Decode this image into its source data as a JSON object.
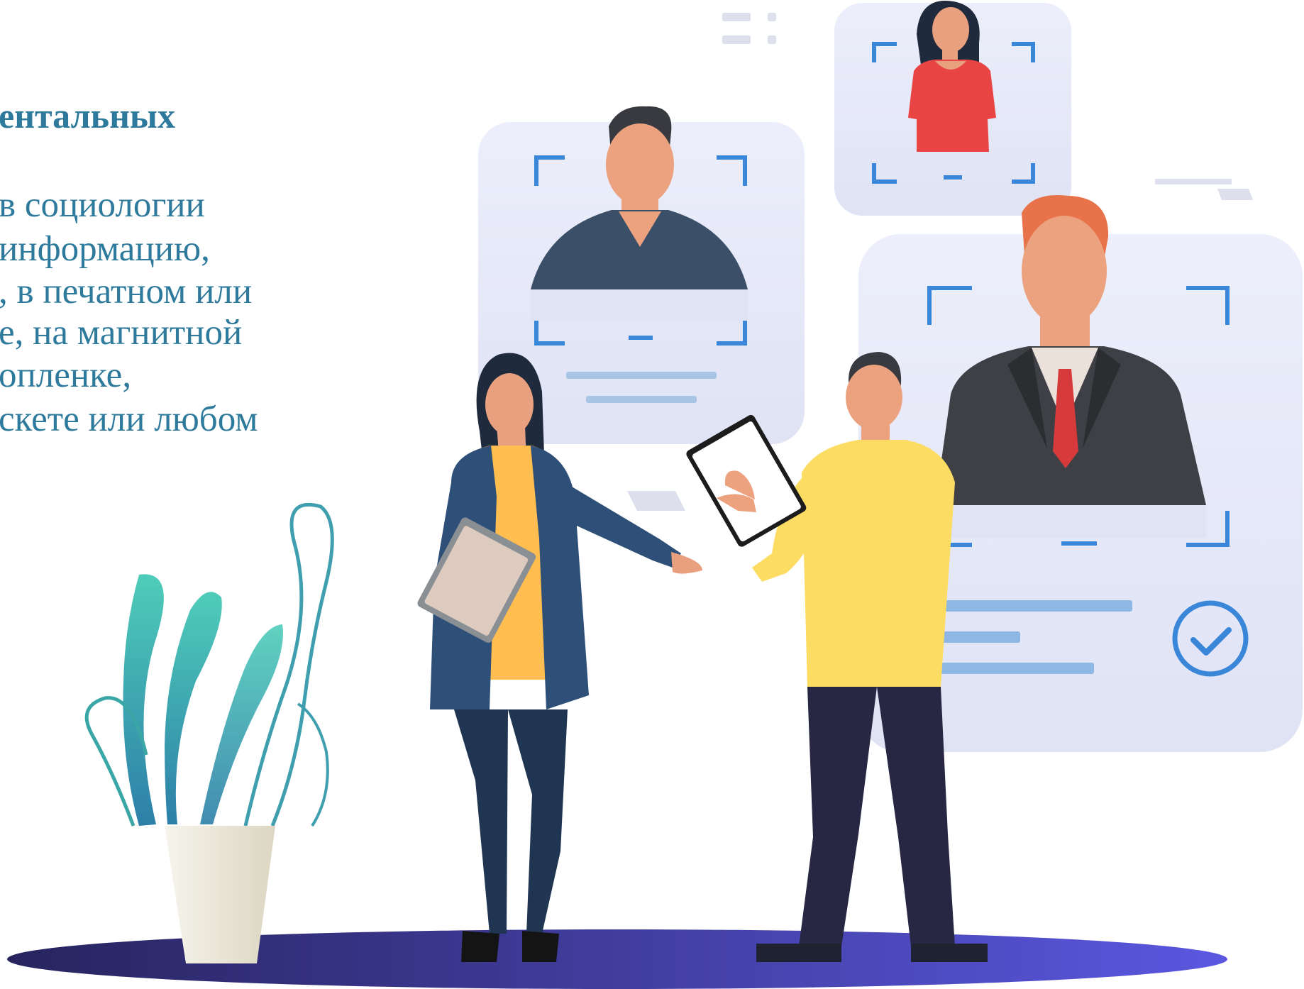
{
  "slide": {
    "heading": "ентальных",
    "body_lines": [
      "в социологии",
      "информацию,",
      ", в печатном или",
      "е, на магнитной",
      "опленке,",
      "скете или любом"
    ]
  },
  "colors": {
    "text": "#2e7a9c",
    "card_background": "#e6e9f7",
    "frame_corner": "#3a86d9",
    "shadow_ellipse_left": "#27245e",
    "shadow_ellipse_right": "#5b57e0",
    "woman_jacket": "#2e4f78",
    "woman_top": "#ffbe4f",
    "man_shirt": "#fddc63",
    "man_pants": "#272744",
    "plant": "#3aa6a6",
    "pot": "#f2efe6",
    "accent_red": "#e84444",
    "hair_orange": "#e8734a"
  },
  "icons": {
    "check": "check-circle-icon"
  }
}
